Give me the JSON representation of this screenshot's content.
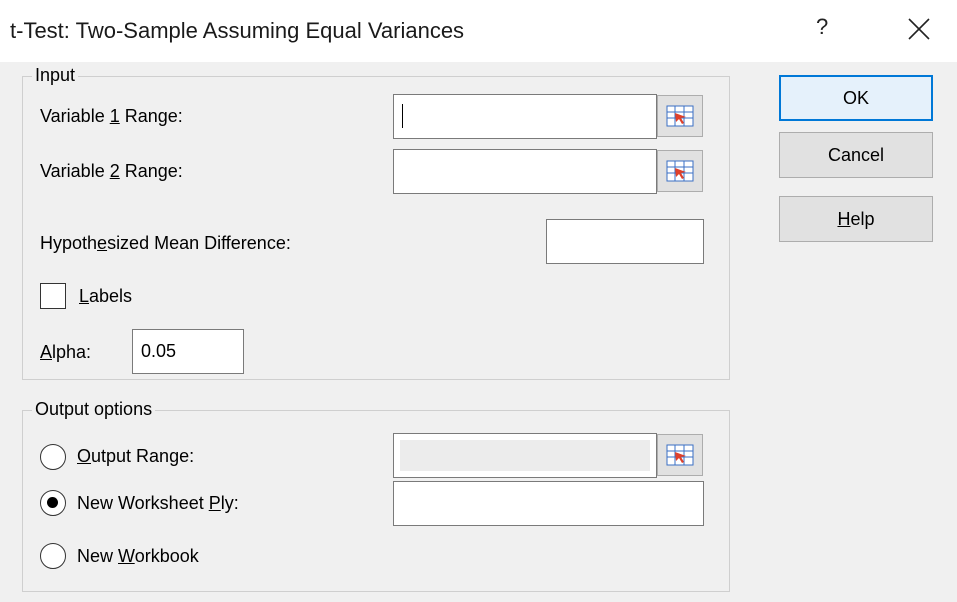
{
  "window": {
    "title": "t-Test: Two-Sample Assuming Equal Variances",
    "help_glyph": "?",
    "close_icon": "close-icon"
  },
  "input_group": {
    "label": "Input",
    "var1": {
      "pre": "Variable ",
      "key": "1",
      "post": " Range:",
      "value": ""
    },
    "var2": {
      "pre": "Variable ",
      "key": "2",
      "post": " Range:",
      "value": ""
    },
    "hmd": {
      "pre": "Hypoth",
      "key": "e",
      "post": "sized Mean Difference:",
      "value": ""
    },
    "labels": {
      "key": "L",
      "post": "abels",
      "checked": false
    },
    "alpha": {
      "key": "A",
      "post": "lpha:",
      "value": "0.05"
    }
  },
  "output_group": {
    "label": "Output options",
    "output_range": {
      "key": "O",
      "post": "utput Range:",
      "selected": false,
      "value": ""
    },
    "new_ply": {
      "pre": "New Worksheet ",
      "key": "P",
      "post": "ly:",
      "selected": true,
      "value": ""
    },
    "new_workbook": {
      "pre": "New ",
      "key": "W",
      "post": "orkbook",
      "selected": false
    }
  },
  "buttons": {
    "ok": "OK",
    "cancel": "Cancel",
    "help": {
      "key": "H",
      "post": "elp"
    }
  },
  "colors": {
    "accent": "#0078d7",
    "dialog_bg": "#f0f0f0",
    "ref_icon_red": "#e0402a",
    "ref_icon_blue": "#3a6fc4"
  }
}
